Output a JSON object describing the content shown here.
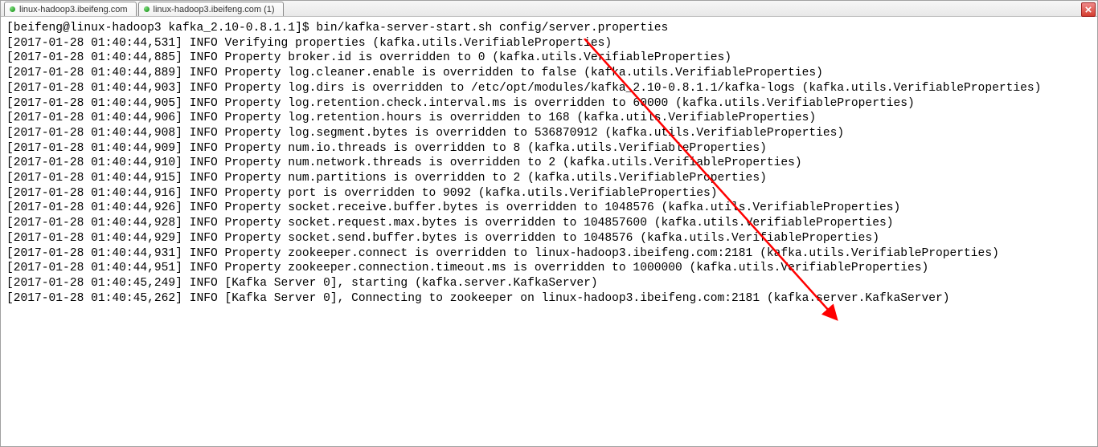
{
  "tabs": [
    {
      "label": "linux-hadoop3.ibeifeng.com",
      "active": true
    },
    {
      "label": "linux-hadoop3.ibeifeng.com (1)",
      "active": false
    }
  ],
  "prompt": "[beifeng@linux-hadoop3 kafka_2.10-0.8.1.1]$ ",
  "command": "bin/kafka-server-start.sh config/server.properties",
  "log_lines": [
    "[2017-01-28 01:40:44,531] INFO Verifying properties (kafka.utils.VerifiableProperties)",
    "[2017-01-28 01:40:44,885] INFO Property broker.id is overridden to 0 (kafka.utils.VerifiableProperties)",
    "[2017-01-28 01:40:44,889] INFO Property log.cleaner.enable is overridden to false (kafka.utils.VerifiableProperties)",
    "[2017-01-28 01:40:44,903] INFO Property log.dirs is overridden to /etc/opt/modules/kafka_2.10-0.8.1.1/kafka-logs (kafka.utils.VerifiableProperties)",
    "[2017-01-28 01:40:44,905] INFO Property log.retention.check.interval.ms is overridden to 60000 (kafka.utils.VerifiableProperties)",
    "[2017-01-28 01:40:44,906] INFO Property log.retention.hours is overridden to 168 (kafka.utils.VerifiableProperties)",
    "[2017-01-28 01:40:44,908] INFO Property log.segment.bytes is overridden to 536870912 (kafka.utils.VerifiableProperties)",
    "[2017-01-28 01:40:44,909] INFO Property num.io.threads is overridden to 8 (kafka.utils.VerifiableProperties)",
    "[2017-01-28 01:40:44,910] INFO Property num.network.threads is overridden to 2 (kafka.utils.VerifiableProperties)",
    "[2017-01-28 01:40:44,915] INFO Property num.partitions is overridden to 2 (kafka.utils.VerifiableProperties)",
    "[2017-01-28 01:40:44,916] INFO Property port is overridden to 9092 (kafka.utils.VerifiableProperties)",
    "[2017-01-28 01:40:44,926] INFO Property socket.receive.buffer.bytes is overridden to 1048576 (kafka.utils.VerifiableProperties)",
    "[2017-01-28 01:40:44,928] INFO Property socket.request.max.bytes is overridden to 104857600 (kafka.utils.VerifiableProperties)",
    "[2017-01-28 01:40:44,929] INFO Property socket.send.buffer.bytes is overridden to 1048576 (kafka.utils.VerifiableProperties)",
    "[2017-01-28 01:40:44,931] INFO Property zookeeper.connect is overridden to linux-hadoop3.ibeifeng.com:2181 (kafka.utils.VerifiableProperties)",
    "[2017-01-28 01:40:44,951] INFO Property zookeeper.connection.timeout.ms is overridden to 1000000 (kafka.utils.VerifiableProperties)",
    "[2017-01-28 01:40:45,249] INFO [Kafka Server 0], starting (kafka.server.KafkaServer)",
    "[2017-01-28 01:40:45,262] INFO [Kafka Server 0], Connecting to zookeeper on linux-hadoop3.ibeifeng.com:2181 (kafka.server.KafkaServer)"
  ],
  "annotation_arrow_color": "#ff0000"
}
